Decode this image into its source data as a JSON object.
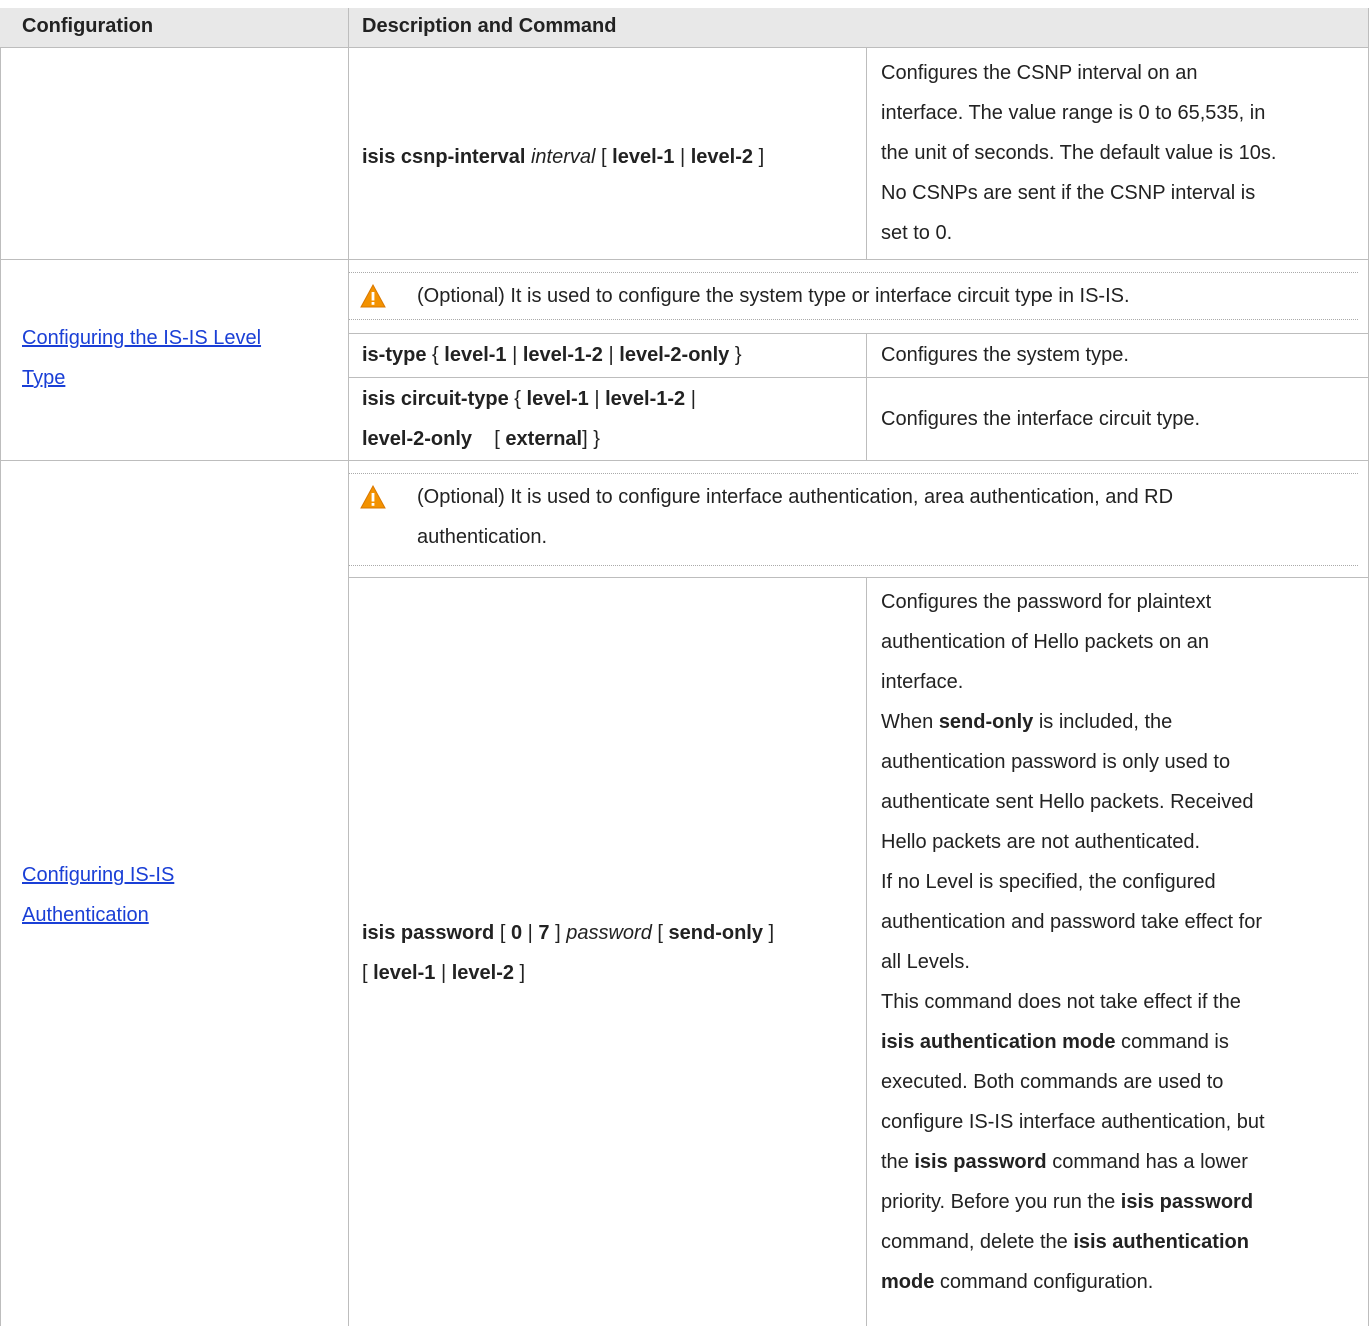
{
  "header": {
    "col1": "Configuration",
    "col2": "Description and Command"
  },
  "csnp": {
    "cmd": {
      "p1": "isis csnp-interval",
      "p2": "interval",
      "p3": "[",
      "p4": "level-1",
      "p5": "|",
      "p6": "level-2",
      "p7": "]"
    },
    "desc": [
      "Configures the CSNP interval on an",
      "interface. The value range is 0 to 65,535, in",
      "the unit of seconds. The default value is 10s.",
      "No CSNPs are sent if the CSNP interval is",
      "set to 0."
    ]
  },
  "level": {
    "link": [
      "Configuring the IS-IS Level",
      "Type"
    ],
    "note": "(Optional) It is used to configure the system type or interface circuit type in IS-IS.",
    "row1": {
      "cmd": {
        "p1": "is-type",
        "p2": "{",
        "p3": "level-1",
        "p4": "|",
        "p5": "level-1-2",
        "p6": "|",
        "p7": "level-2-only",
        "p8": "}"
      },
      "desc": "Configures the system type."
    },
    "row2": {
      "cmd1": {
        "p1": "isis circuit-type",
        "p2": "{",
        "p3": "level-1",
        "p4": "|",
        "p5": "level-1-2",
        "p6": "|"
      },
      "cmd2": {
        "p1": "level-2-only",
        "p2": "[",
        "p3": "external",
        "p4": "] }"
      },
      "desc": "Configures the interface circuit type."
    }
  },
  "auth": {
    "link": [
      "Configuring IS-IS",
      "Authentication"
    ],
    "note": [
      "(Optional) It is used to configure interface authentication, area authentication, and RD",
      "authentication."
    ],
    "cmd1": {
      "p1": "isis password",
      "p2": "[",
      "p3": "0",
      "p4": "|",
      "p5": "7",
      "p6": "]",
      "p7": "password",
      "p8": "[",
      "p9": "send-only",
      "p10": "]"
    },
    "cmd2": {
      "p1": "[",
      "p2": "level-1",
      "p3": "|",
      "p4": "level-2",
      "p5": "]"
    },
    "desc": {
      "l1": "Configures the password for plaintext",
      "l2": "authentication of Hello packets on an",
      "l3": "interface.",
      "l4a": "When",
      "l4b": "send-only",
      "l4c": "is included, the",
      "l5": "authentication password is only used to",
      "l6": "authenticate sent Hello packets. Received",
      "l7": "Hello packets are not authenticated.",
      "l8": "If no Level is specified, the configured",
      "l9": "authentication and password take effect for",
      "l10": "all Levels.",
      "l11": "This command does not take effect if the",
      "l12a": "isis authentication mode",
      "l12b": "command is",
      "l13": "executed. Both commands are used to",
      "l14": "configure IS-IS interface authentication, but",
      "l15a": "the",
      "l15b": "isis password",
      "l15c": "command has a lower",
      "l16a": "priority. Before you run the",
      "l16b": "isis password",
      "l17a": "command, delete the",
      "l17b": "isis authentication",
      "l18a": "mode",
      "l18b": "command configuration."
    }
  },
  "icons": {
    "warning": "warning-icon"
  },
  "colors": {
    "link": "#1a3fd6",
    "header_bg": "#e8e8e8",
    "warning": "#f39200"
  }
}
